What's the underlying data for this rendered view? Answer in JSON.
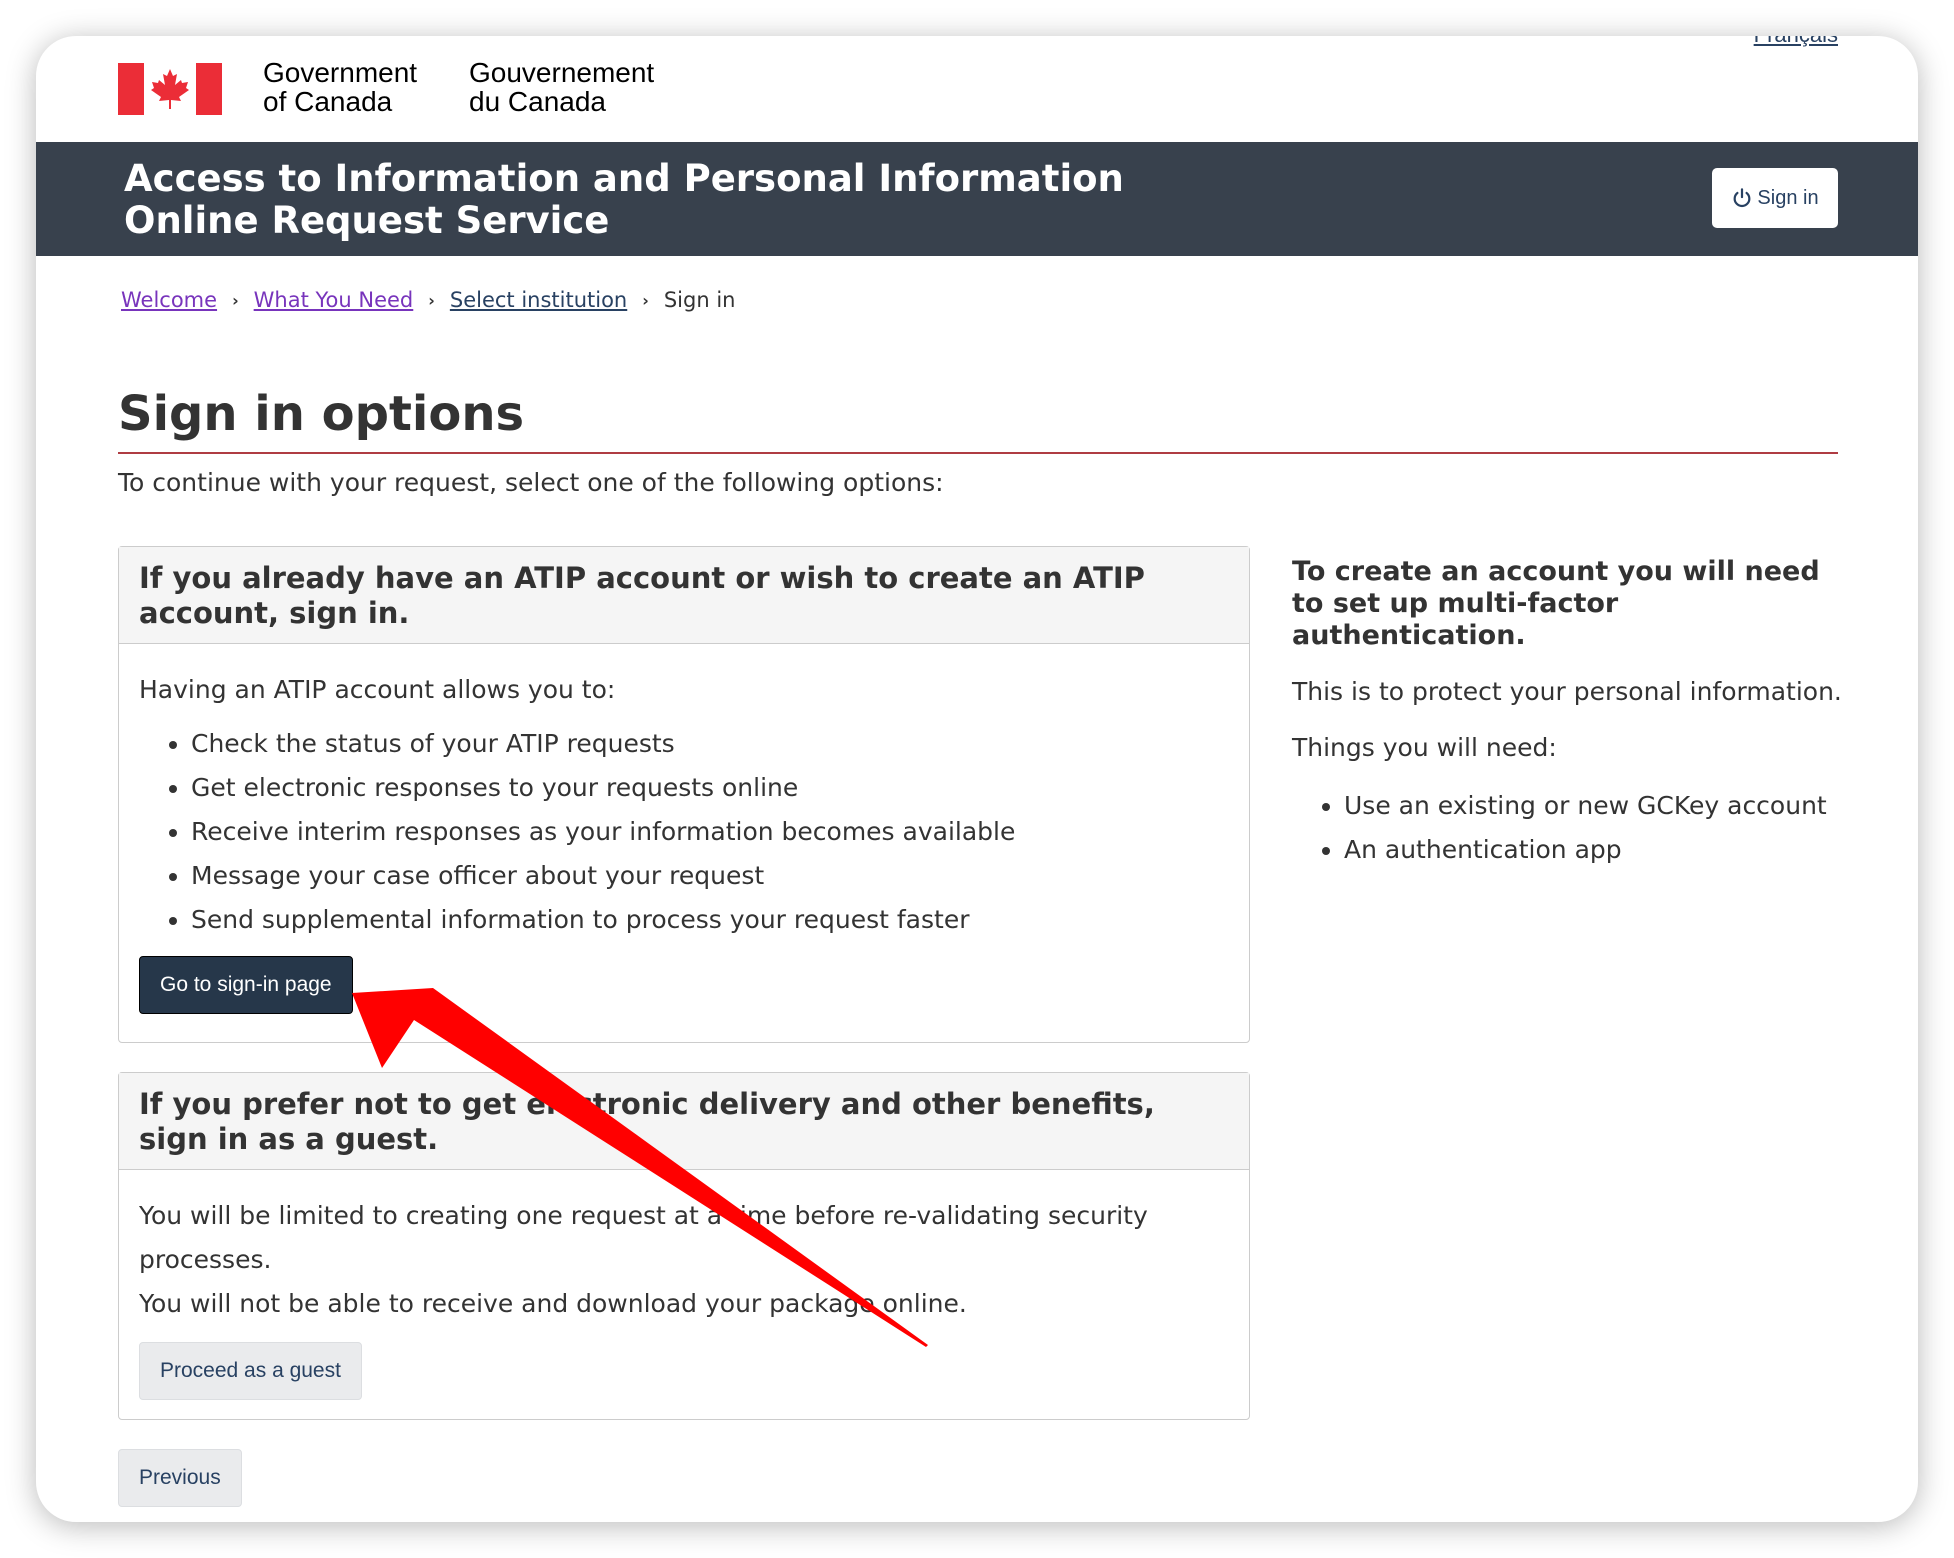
{
  "header": {
    "signature_en_line1": "Government",
    "signature_en_line2": "of Canada",
    "signature_fr_line1": "Gouvernement",
    "signature_fr_line2": "du Canada",
    "language_link": "Français",
    "flag_color": "#eb2d37"
  },
  "band": {
    "title_line1": "Access to Information and Personal Information",
    "title_line2": "Online Request Service",
    "signin_label": "Sign in",
    "background": "#38414d"
  },
  "breadcrumb": {
    "items": [
      "Welcome",
      "What You Need",
      "Select institution"
    ],
    "current": "Sign in"
  },
  "main": {
    "title": "Sign in options",
    "intro": "To continue with your request, select one of the following options:"
  },
  "account_panel": {
    "heading": "If you already have an ATIP account or wish to create an ATIP account, sign in.",
    "lead": "Having an ATIP account allows you to:",
    "benefits": [
      "Check the status of your ATIP requests",
      "Get electronic responses to your requests online",
      "Receive interim responses as your information becomes available",
      "Message your case officer about your request",
      "Send supplemental information to process your request faster"
    ],
    "button_label": "Go to sign-in page"
  },
  "guest_panel": {
    "heading": "If you prefer not to get electronic delivery and other benefits, sign in as a guest.",
    "text1": "You will be limited to creating one request at a time before re-validating security processes.",
    "text2": "You will not be able to receive and download your package online.",
    "button_label": "Proceed as a guest"
  },
  "previous_button": "Previous",
  "aside": {
    "heading": "To create an account you will need to set up multi-factor authentication.",
    "text": "This is to protect your personal information.",
    "needs_label": "Things you will need:",
    "needs": [
      "Use an existing or new GCKey account",
      "An authentication app"
    ]
  },
  "annotation": {
    "arrow_color": "#ff0000",
    "arrow_icon": "red-arrow-pointer"
  }
}
